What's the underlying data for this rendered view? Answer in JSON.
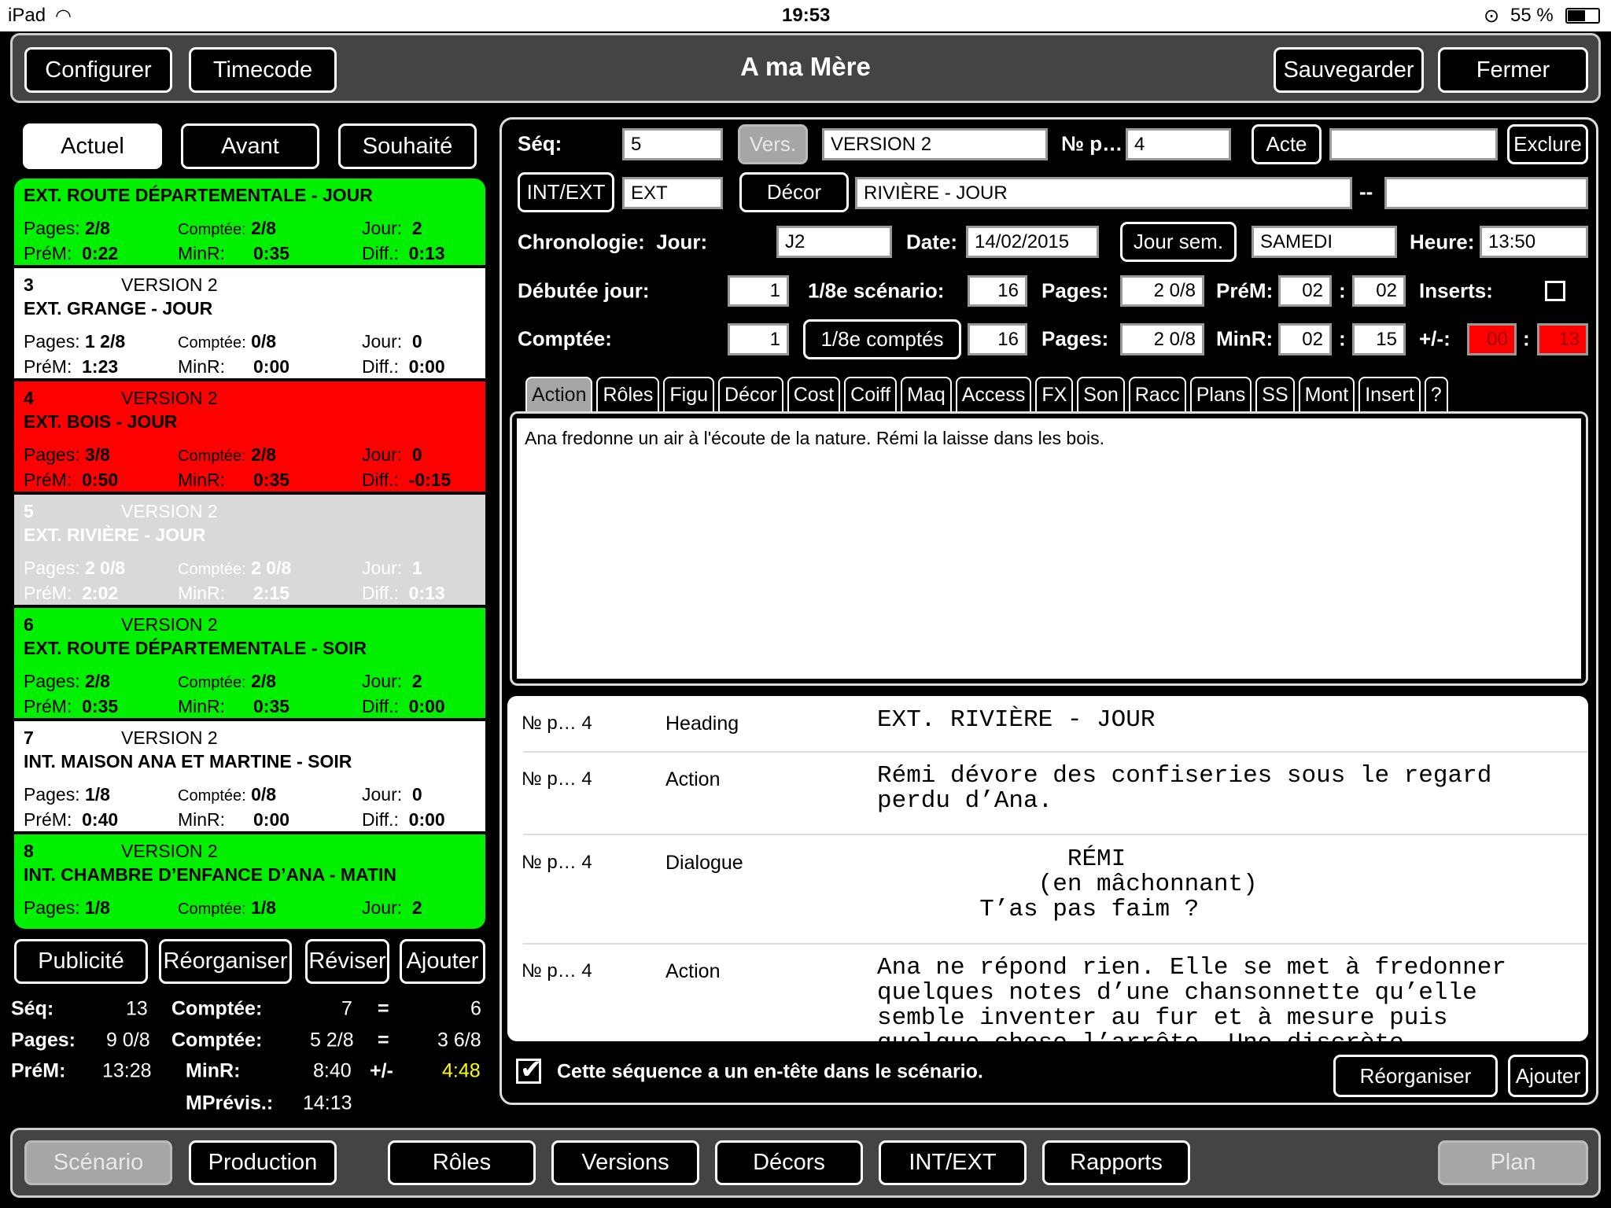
{
  "status": {
    "device": "iPad",
    "time": "19:53",
    "battery": "55 %"
  },
  "header": {
    "title": "A ma Mère",
    "configure": "Configurer",
    "timecode": "Timecode",
    "save": "Sauvegarder",
    "close": "Fermer"
  },
  "view_tabs": [
    {
      "label": "Actuel",
      "active": true
    },
    {
      "label": "Avant"
    },
    {
      "label": "Souhaité"
    }
  ],
  "sequences": [
    {
      "num": "",
      "version": "",
      "heading": "EXT. ROUTE DÉPARTEMENTALE - JOUR",
      "pages": "2/8",
      "comptee": "2/8",
      "jour": "2",
      "prem": "0:22",
      "minr": "0:35",
      "diff": "0:13",
      "color": "green"
    },
    {
      "num": "3",
      "version": "VERSION 2",
      "heading": "EXT. GRANGE - JOUR",
      "pages": "1 2/8",
      "comptee": "0/8",
      "jour": "0",
      "prem": "1:23",
      "minr": "0:00",
      "diff": "0:00",
      "color": "white"
    },
    {
      "num": "4",
      "version": "VERSION 2",
      "heading": "EXT. BOIS - JOUR",
      "pages": "3/8",
      "comptee": "2/8",
      "jour": "0",
      "prem": "0:50",
      "minr": "0:35",
      "diff": "-0:15",
      "color": "red"
    },
    {
      "num": "5",
      "version": "VERSION 2",
      "heading": "EXT. RIVIÈRE - JOUR",
      "pages": "2 0/8",
      "comptee": "2 0/8",
      "jour": "1",
      "prem": "2:02",
      "minr": "2:15",
      "diff": "0:13",
      "color": "selected"
    },
    {
      "num": "6",
      "version": "VERSION 2",
      "heading": "EXT. ROUTE DÉPARTEMENTALE - SOIR",
      "pages": "2/8",
      "comptee": "2/8",
      "jour": "2",
      "prem": "0:35",
      "minr": "0:35",
      "diff": "0:00",
      "color": "green"
    },
    {
      "num": "7",
      "version": "VERSION 2",
      "heading": "INT. MAISON ANA ET MARTINE - SOIR",
      "pages": "1/8",
      "comptee": "0/8",
      "jour": "0",
      "prem": "0:40",
      "minr": "0:00",
      "diff": "0:00",
      "color": "white"
    },
    {
      "num": "8",
      "version": "VERSION 2",
      "heading": "INT. CHAMBRE D’ENFANCE D’ANA - MATIN",
      "pages": "1/8",
      "comptee": "1/8",
      "jour": "2",
      "color": "green"
    }
  ],
  "row_labels": {
    "pages": "Pages:",
    "comptee": "Comptée:",
    "jour": "Jour:",
    "prem": "PréM:",
    "minr": "MinR:",
    "diff": "Diff.:"
  },
  "row_colors": {
    "green": "#00f000",
    "white": "#ffffff",
    "red": "#ff0000",
    "selected": "#d9d9d9"
  },
  "list_actions": {
    "publicite": "Publicité",
    "reorganiser": "Réorganiser",
    "reviser": "Réviser",
    "ajouter": "Ajouter"
  },
  "totals": {
    "seq_label": "Séq:",
    "seq": "13",
    "comptee_label": "Comptée:",
    "seq_comptee": "7",
    "eq": "=",
    "seq_rest": "6",
    "pages_label": "Pages:",
    "pages": "9 0/8",
    "pages_comptee": "5 2/8",
    "pages_rest": "3 6/8",
    "prem_label": "PréM:",
    "prem": "13:28",
    "minr_label": "MinR:",
    "minr": "8:40",
    "pm": "+/-",
    "diff": "4:48",
    "mprevis_label": "MPrévis.:",
    "mprevis": "14:13",
    "diff_color": "#ffff00"
  },
  "form": {
    "seq_label": "Séq:",
    "seq": "5",
    "vers_btn": "Vers.",
    "version": "VERSION 2",
    "np_label": "№ p…",
    "np": "4",
    "acte_btn": "Acte",
    "acte": "",
    "exclure_btn": "Exclure",
    "intext_btn": "INT/EXT",
    "intext": "EXT",
    "decor_btn": "Décor",
    "decor": "RIVIÈRE - JOUR",
    "dash": "--",
    "decor2": "",
    "chrono_label": "Chronologie:  Jour:",
    "jour": "J2",
    "date_label": "Date:",
    "date": "14/02/2015",
    "joursem_btn": "Jour sem.",
    "joursem": "SAMEDI",
    "heure_label": "Heure:",
    "heure": "13:50",
    "debutee_label": "Débutée jour:",
    "debutee": "1",
    "h8_label": "1/8e scénario:",
    "h8": "16",
    "pages_label": "Pages:",
    "pages": "2 0/8",
    "prem_label": "PréM:",
    "prem_m": "02",
    "colon": ":",
    "prem_s": "02",
    "inserts_label": "Inserts:",
    "inserts_checked": false,
    "comptee_label": "Comptée:",
    "comptee": "1",
    "h8c_btn": "1/8e comptés",
    "h8c": "16",
    "pages2": "2 0/8",
    "minr_label": "MinR:",
    "minr_m": "02",
    "minr_s": "15",
    "pm_label": "+/-:",
    "pm_m": "00",
    "pm_s": "13"
  },
  "detail_tabs": [
    "Action",
    "Rôles",
    "Figu",
    "Décor",
    "Cost",
    "Coiff",
    "Maq",
    "Access",
    "FX",
    "Son",
    "Racc",
    "Plans",
    "SS",
    "Mont",
    "Insert",
    "?"
  ],
  "action_text": "Ana fredonne un air à l'écoute de la nature. Rémi la laisse dans les bois.",
  "script": [
    {
      "np": "№ p… 4",
      "type": "Heading",
      "text": "EXT. RIVIÈRE - JOUR"
    },
    {
      "np": "№ p… 4",
      "type": "Action",
      "text": "Rémi dévore des confiseries sous le regard\nperdu d’Ana."
    },
    {
      "np": "№ p… 4",
      "type": "Dialogue",
      "text": "             RÉMI\n           (en mâchonnant)\n       T’as pas faim ?"
    },
    {
      "np": "№ p… 4",
      "type": "Action",
      "text": "Ana ne répond rien. Elle se met à fredonner\nquelques notes d’une chansonnette qu’elle\nsemble inventer au fur et à mesure puis\nquelque chose l’arrête. Une discrète"
    }
  ],
  "heading_note": {
    "checked": true,
    "label": "Cette séquence a un en-tête dans le scénario.",
    "reorganiser": "Réorganiser",
    "ajouter": "Ajouter"
  },
  "bottom_nav": [
    {
      "label": "Scénario",
      "active": true
    },
    {
      "label": "Production"
    },
    {
      "label": "Rôles"
    },
    {
      "label": "Versions"
    },
    {
      "label": "Décors"
    },
    {
      "label": "INT/EXT"
    },
    {
      "label": "Rapports"
    },
    {
      "label": "Plan",
      "disabled": true
    }
  ]
}
